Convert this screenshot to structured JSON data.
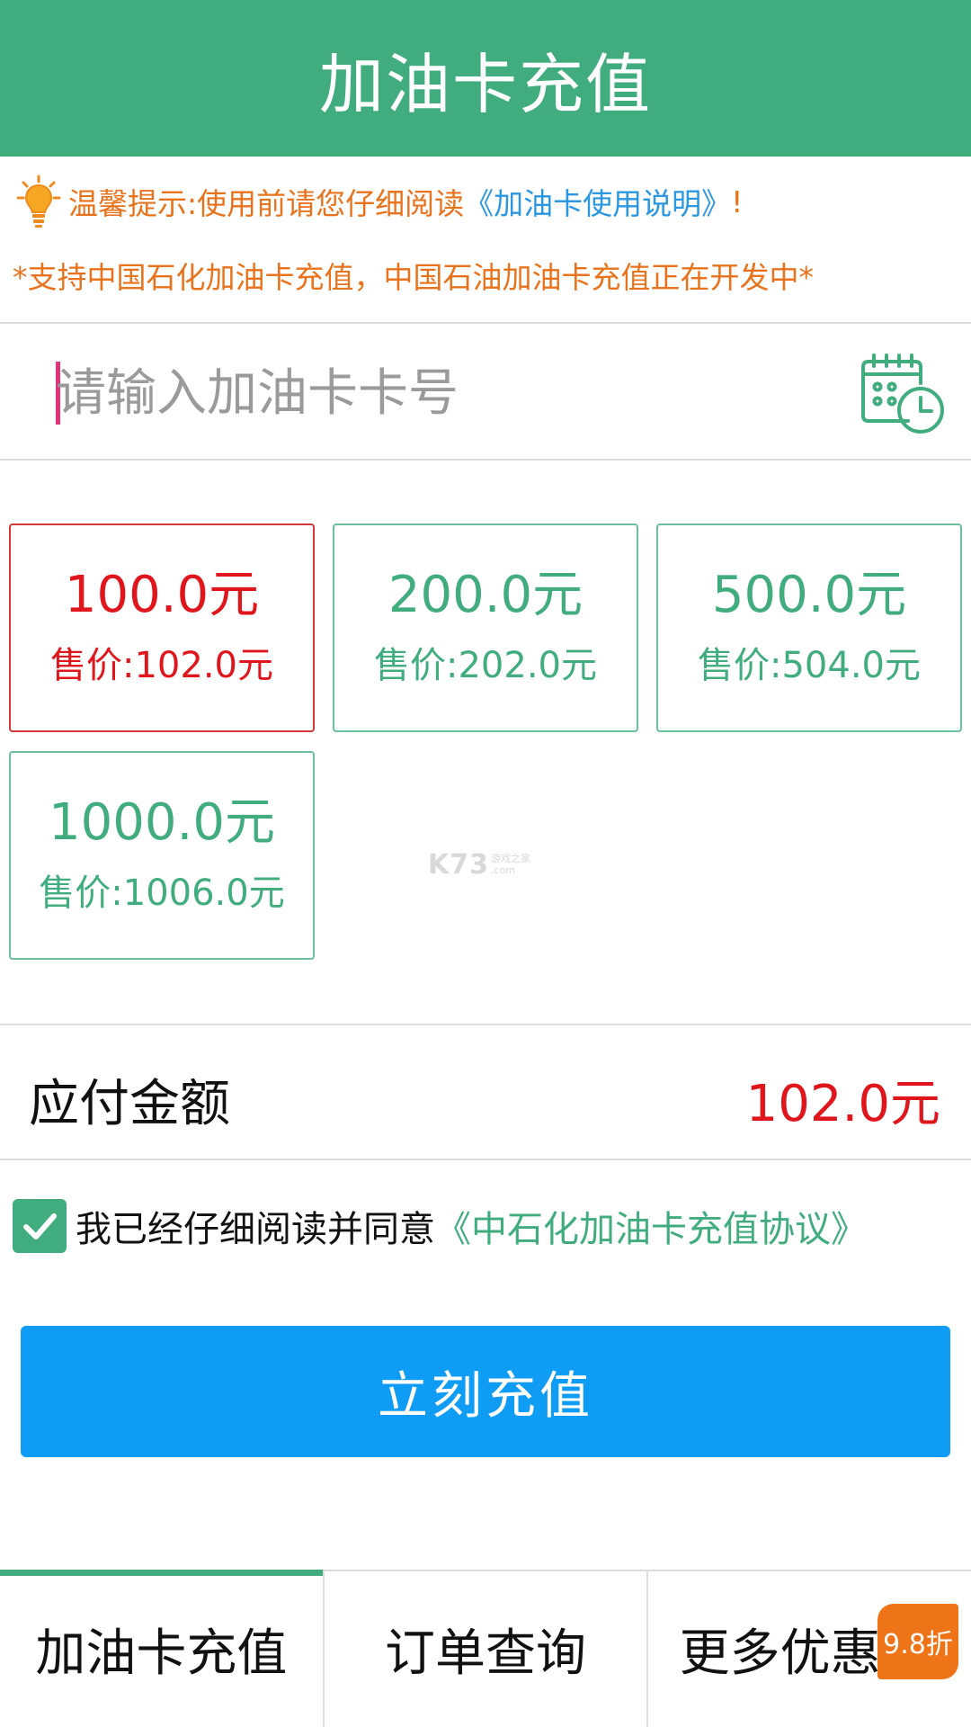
{
  "header": {
    "title": "加油卡充值"
  },
  "notice": {
    "tip_prefix": "温馨提示:使用前请您仔细阅读",
    "tip_link": "《加油卡使用说明》",
    "tip_suffix": "!",
    "support_text": "*支持中国石化加油卡充值，中国石油加油卡充值正在开发中*"
  },
  "card_input": {
    "placeholder": "请输入加油卡卡号",
    "value": ""
  },
  "options": [
    {
      "face": "100.0元",
      "price": "售价:102.0元",
      "selected": true
    },
    {
      "face": "200.0元",
      "price": "售价:202.0元",
      "selected": false
    },
    {
      "face": "500.0元",
      "price": "售价:504.0元",
      "selected": false
    },
    {
      "face": "1000.0元",
      "price": "售价:1006.0元",
      "selected": false
    }
  ],
  "watermark": {
    "main": "K73",
    "sub1": "游戏之家",
    "sub2": ".com"
  },
  "payment": {
    "label": "应付金额",
    "amount": "102.0元"
  },
  "agreement": {
    "checked": true,
    "text": "我已经仔细阅读并同意",
    "link": "《中石化加油卡充值协议》"
  },
  "submit_label": "立刻充值",
  "tabs": [
    {
      "label": "加油卡充值",
      "active": true
    },
    {
      "label": "订单查询",
      "active": false
    },
    {
      "label": "更多优惠",
      "active": false,
      "badge": "9.8折"
    }
  ],
  "colors": {
    "brand_green": "#41ad7f",
    "accent_blue": "#0f9cf5",
    "price_red": "#e0161d",
    "notice_orange": "#e8731c",
    "link_blue": "#2a97e0",
    "badge_orange": "#ef7418"
  },
  "icons": [
    "lightbulb-icon",
    "calendar-clock-icon",
    "checkmark-icon"
  ]
}
